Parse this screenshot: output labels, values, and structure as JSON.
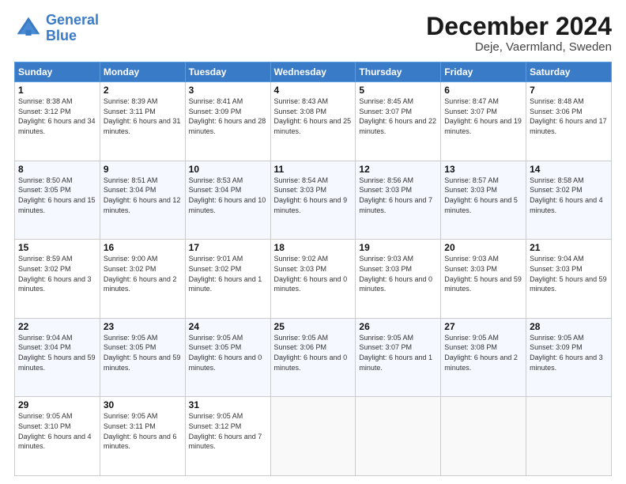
{
  "header": {
    "logo_line1": "General",
    "logo_line2": "Blue",
    "title": "December 2024",
    "subtitle": "Deje, Vaermland, Sweden"
  },
  "weekdays": [
    "Sunday",
    "Monday",
    "Tuesday",
    "Wednesday",
    "Thursday",
    "Friday",
    "Saturday"
  ],
  "weeks": [
    [
      {
        "day": "1",
        "sunrise": "Sunrise: 8:38 AM",
        "sunset": "Sunset: 3:12 PM",
        "daylight": "Daylight: 6 hours and 34 minutes."
      },
      {
        "day": "2",
        "sunrise": "Sunrise: 8:39 AM",
        "sunset": "Sunset: 3:11 PM",
        "daylight": "Daylight: 6 hours and 31 minutes."
      },
      {
        "day": "3",
        "sunrise": "Sunrise: 8:41 AM",
        "sunset": "Sunset: 3:09 PM",
        "daylight": "Daylight: 6 hours and 28 minutes."
      },
      {
        "day": "4",
        "sunrise": "Sunrise: 8:43 AM",
        "sunset": "Sunset: 3:08 PM",
        "daylight": "Daylight: 6 hours and 25 minutes."
      },
      {
        "day": "5",
        "sunrise": "Sunrise: 8:45 AM",
        "sunset": "Sunset: 3:07 PM",
        "daylight": "Daylight: 6 hours and 22 minutes."
      },
      {
        "day": "6",
        "sunrise": "Sunrise: 8:47 AM",
        "sunset": "Sunset: 3:07 PM",
        "daylight": "Daylight: 6 hours and 19 minutes."
      },
      {
        "day": "7",
        "sunrise": "Sunrise: 8:48 AM",
        "sunset": "Sunset: 3:06 PM",
        "daylight": "Daylight: 6 hours and 17 minutes."
      }
    ],
    [
      {
        "day": "8",
        "sunrise": "Sunrise: 8:50 AM",
        "sunset": "Sunset: 3:05 PM",
        "daylight": "Daylight: 6 hours and 15 minutes."
      },
      {
        "day": "9",
        "sunrise": "Sunrise: 8:51 AM",
        "sunset": "Sunset: 3:04 PM",
        "daylight": "Daylight: 6 hours and 12 minutes."
      },
      {
        "day": "10",
        "sunrise": "Sunrise: 8:53 AM",
        "sunset": "Sunset: 3:04 PM",
        "daylight": "Daylight: 6 hours and 10 minutes."
      },
      {
        "day": "11",
        "sunrise": "Sunrise: 8:54 AM",
        "sunset": "Sunset: 3:03 PM",
        "daylight": "Daylight: 6 hours and 9 minutes."
      },
      {
        "day": "12",
        "sunrise": "Sunrise: 8:56 AM",
        "sunset": "Sunset: 3:03 PM",
        "daylight": "Daylight: 6 hours and 7 minutes."
      },
      {
        "day": "13",
        "sunrise": "Sunrise: 8:57 AM",
        "sunset": "Sunset: 3:03 PM",
        "daylight": "Daylight: 6 hours and 5 minutes."
      },
      {
        "day": "14",
        "sunrise": "Sunrise: 8:58 AM",
        "sunset": "Sunset: 3:02 PM",
        "daylight": "Daylight: 6 hours and 4 minutes."
      }
    ],
    [
      {
        "day": "15",
        "sunrise": "Sunrise: 8:59 AM",
        "sunset": "Sunset: 3:02 PM",
        "daylight": "Daylight: 6 hours and 3 minutes."
      },
      {
        "day": "16",
        "sunrise": "Sunrise: 9:00 AM",
        "sunset": "Sunset: 3:02 PM",
        "daylight": "Daylight: 6 hours and 2 minutes."
      },
      {
        "day": "17",
        "sunrise": "Sunrise: 9:01 AM",
        "sunset": "Sunset: 3:02 PM",
        "daylight": "Daylight: 6 hours and 1 minute."
      },
      {
        "day": "18",
        "sunrise": "Sunrise: 9:02 AM",
        "sunset": "Sunset: 3:03 PM",
        "daylight": "Daylight: 6 hours and 0 minutes."
      },
      {
        "day": "19",
        "sunrise": "Sunrise: 9:03 AM",
        "sunset": "Sunset: 3:03 PM",
        "daylight": "Daylight: 6 hours and 0 minutes."
      },
      {
        "day": "20",
        "sunrise": "Sunrise: 9:03 AM",
        "sunset": "Sunset: 3:03 PM",
        "daylight": "Daylight: 5 hours and 59 minutes."
      },
      {
        "day": "21",
        "sunrise": "Sunrise: 9:04 AM",
        "sunset": "Sunset: 3:03 PM",
        "daylight": "Daylight: 5 hours and 59 minutes."
      }
    ],
    [
      {
        "day": "22",
        "sunrise": "Sunrise: 9:04 AM",
        "sunset": "Sunset: 3:04 PM",
        "daylight": "Daylight: 5 hours and 59 minutes."
      },
      {
        "day": "23",
        "sunrise": "Sunrise: 9:05 AM",
        "sunset": "Sunset: 3:05 PM",
        "daylight": "Daylight: 5 hours and 59 minutes."
      },
      {
        "day": "24",
        "sunrise": "Sunrise: 9:05 AM",
        "sunset": "Sunset: 3:05 PM",
        "daylight": "Daylight: 6 hours and 0 minutes."
      },
      {
        "day": "25",
        "sunrise": "Sunrise: 9:05 AM",
        "sunset": "Sunset: 3:06 PM",
        "daylight": "Daylight: 6 hours and 0 minutes."
      },
      {
        "day": "26",
        "sunrise": "Sunrise: 9:05 AM",
        "sunset": "Sunset: 3:07 PM",
        "daylight": "Daylight: 6 hours and 1 minute."
      },
      {
        "day": "27",
        "sunrise": "Sunrise: 9:05 AM",
        "sunset": "Sunset: 3:08 PM",
        "daylight": "Daylight: 6 hours and 2 minutes."
      },
      {
        "day": "28",
        "sunrise": "Sunrise: 9:05 AM",
        "sunset": "Sunset: 3:09 PM",
        "daylight": "Daylight: 6 hours and 3 minutes."
      }
    ],
    [
      {
        "day": "29",
        "sunrise": "Sunrise: 9:05 AM",
        "sunset": "Sunset: 3:10 PM",
        "daylight": "Daylight: 6 hours and 4 minutes."
      },
      {
        "day": "30",
        "sunrise": "Sunrise: 9:05 AM",
        "sunset": "Sunset: 3:11 PM",
        "daylight": "Daylight: 6 hours and 6 minutes."
      },
      {
        "day": "31",
        "sunrise": "Sunrise: 9:05 AM",
        "sunset": "Sunset: 3:12 PM",
        "daylight": "Daylight: 6 hours and 7 minutes."
      },
      null,
      null,
      null,
      null
    ]
  ]
}
